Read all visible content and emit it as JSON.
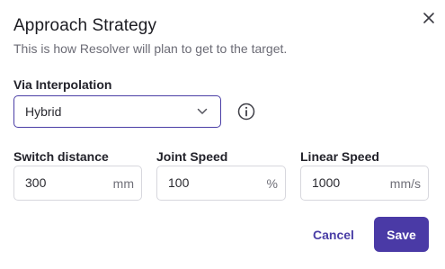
{
  "dialog": {
    "title": "Approach Strategy",
    "subtitle": "This is how Resolver will plan to get to the target."
  },
  "interpolation": {
    "label": "Via Interpolation",
    "selected": "Hybrid"
  },
  "fields": [
    {
      "label": "Switch distance",
      "value": "300",
      "unit": "mm"
    },
    {
      "label": "Joint Speed",
      "value": "100",
      "unit": "%"
    },
    {
      "label": "Linear Speed",
      "value": "1000",
      "unit": "mm/s"
    }
  ],
  "actions": {
    "cancel_label": "Cancel",
    "save_label": "Save"
  },
  "colors": {
    "accent": "#4a3aa6",
    "border": "#d7d7dd",
    "muted_text": "#6b6b75"
  },
  "icons": {
    "close": "close-icon",
    "chevron": "chevron-down-icon",
    "info": "info-icon"
  }
}
